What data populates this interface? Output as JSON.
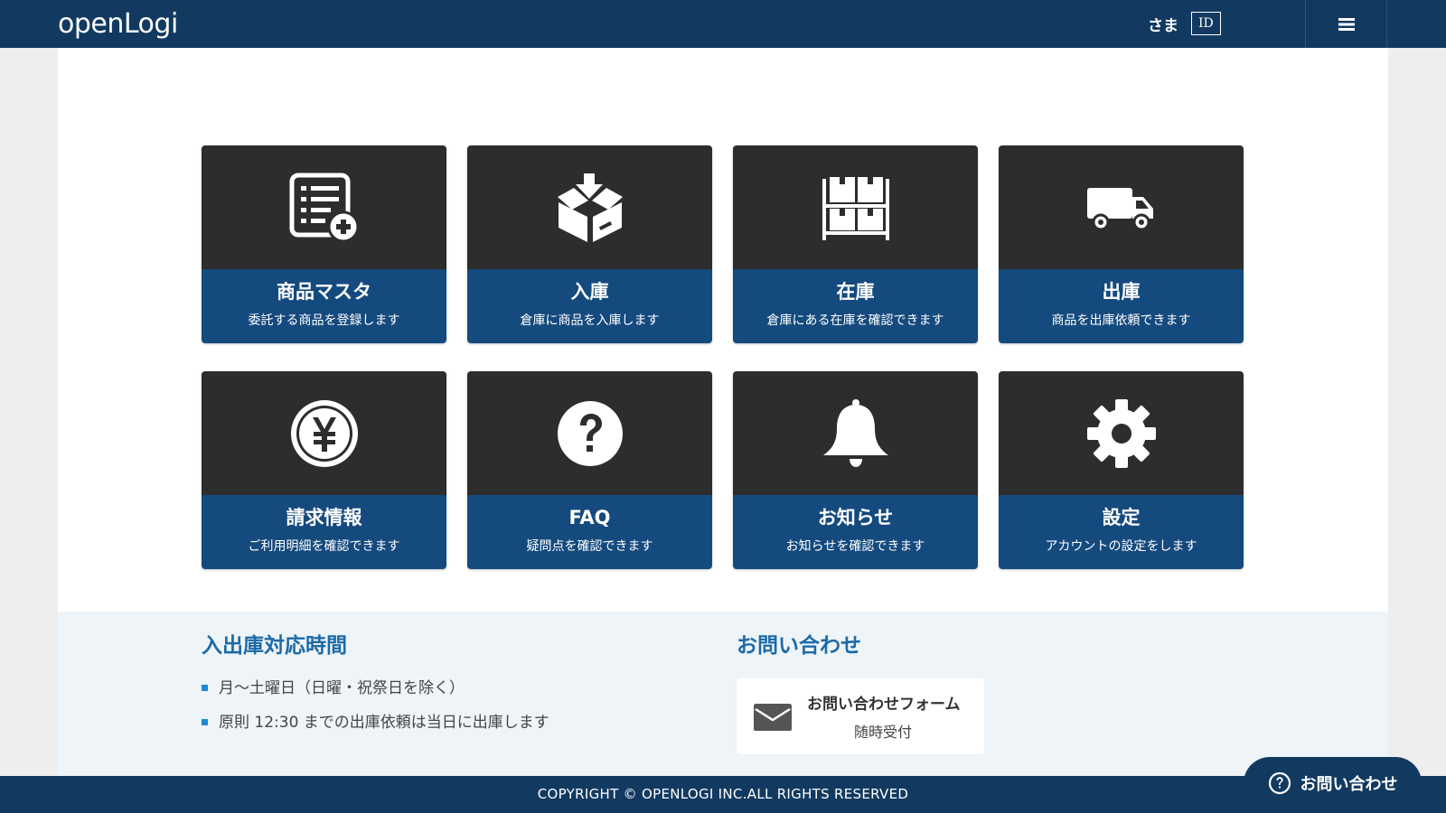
{
  "header": {
    "logo_text": "openLogi",
    "user_suffix": "さま",
    "user_id_label": "ID",
    "menu_icon": "hamburger-icon"
  },
  "tiles": [
    {
      "title": "商品マスタ",
      "desc": "委託する商品を登録します",
      "icon": "product-list-add-icon"
    },
    {
      "title": "入庫",
      "desc": "倉庫に商品を入庫します",
      "icon": "box-inbound-icon"
    },
    {
      "title": "在庫",
      "desc": "倉庫にある在庫を確認できます",
      "icon": "shelf-boxes-icon"
    },
    {
      "title": "出庫",
      "desc": "商品を出庫依頼できます",
      "icon": "truck-icon"
    },
    {
      "title": "請求情報",
      "desc": "ご利用明細を確認できます",
      "icon": "yen-coin-icon"
    },
    {
      "title": "FAQ",
      "desc": "疑問点を確認できます",
      "icon": "question-icon"
    },
    {
      "title": "お知らせ",
      "desc": "お知らせを確認できます",
      "icon": "bell-icon"
    },
    {
      "title": "設定",
      "desc": "アカウントの設定をします",
      "icon": "gear-icon"
    }
  ],
  "hours": {
    "heading": "入出庫対応時間",
    "items": [
      "月～土曜日（日曜・祝祭日を除く）",
      "原則 12:30 までの出庫依頼は当日に出庫します"
    ]
  },
  "contact": {
    "heading": "お問い合わせ",
    "form_title": "お問い合わせフォーム",
    "form_sub": "随時受付"
  },
  "footer": {
    "copyright": "COPYRIGHT © OPENLOGI INC.ALL RIGHTS RESERVED"
  },
  "floating_contact": {
    "label": "お問い合わせ"
  },
  "colors": {
    "header_bg": "#123a61",
    "tile_top": "#2d2d2d",
    "tile_bottom": "#154a7e",
    "heading_blue": "#1c6aa8",
    "bullet_blue": "#1c8ad4"
  }
}
